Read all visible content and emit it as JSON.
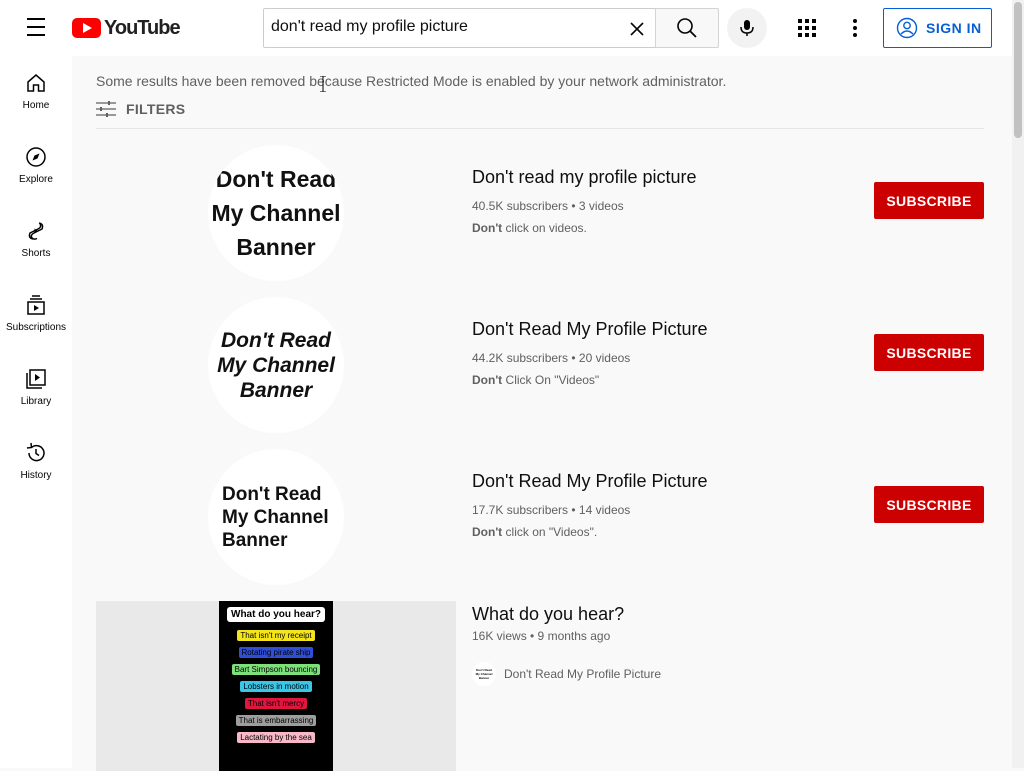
{
  "header": {
    "logo_text": "YouTube",
    "search_value": "don't read my profile picture",
    "signin_label": "SIGN IN"
  },
  "sidebar": {
    "items": [
      {
        "label": "Home",
        "icon": "home-icon"
      },
      {
        "label": "Explore",
        "icon": "compass-icon"
      },
      {
        "label": "Shorts",
        "icon": "shorts-icon"
      },
      {
        "label": "Subscriptions",
        "icon": "subscriptions-icon"
      },
      {
        "label": "Library",
        "icon": "library-icon"
      },
      {
        "label": "History",
        "icon": "history-icon"
      }
    ]
  },
  "main": {
    "notice": "Some results have been removed because Restricted Mode is enabled by your network administrator.",
    "filters_label": "FILTERS",
    "subscribe_label": "SUBSCRIBE",
    "channels": [
      {
        "avatar_lines": [
          "Don't Read",
          "My Channel",
          "Banner"
        ],
        "title": "Don't read my profile picture",
        "meta": "40.5K subscribers • 3 videos",
        "desc_bold": "Don't",
        "desc_rest": " click on videos."
      },
      {
        "avatar_lines": [
          "Don't Read",
          "My Channel",
          "Banner"
        ],
        "title": "Don't Read My Profile Picture",
        "meta": "44.2K subscribers • 20 videos",
        "desc_bold": "Don't",
        "desc_rest": " Click On \"Videos\""
      },
      {
        "avatar_lines": [
          "Don't Read",
          "My Channel",
          "Banner"
        ],
        "title": "Don't Read My Profile Picture",
        "meta": "17.7K subscribers • 14 videos",
        "desc_bold": "Don't",
        "desc_rest": " click on \"Videos\"."
      }
    ],
    "video": {
      "title": "What do you hear?",
      "meta": "16K views • 9 months ago",
      "channel_name": "Don't Read My Profile Picture",
      "channel_avatar_lines": [
        "Don't Read",
        "My Channel",
        "Banner"
      ],
      "thumb_heading": "What do you hear?",
      "thumb_chips": [
        {
          "text": "That isn't my receipt",
          "color": "#f5e51b"
        },
        {
          "text": "Rotating pirate ship",
          "color": "#2f4fd8"
        },
        {
          "text": "Bart Simpson bouncing",
          "color": "#7de07a"
        },
        {
          "text": "Lobsters in motion",
          "color": "#3ac6e8"
        },
        {
          "text": "That isn't mercy",
          "color": "#e0163f"
        },
        {
          "text": "That is embarrassing",
          "color": "#9e9e9e"
        },
        {
          "text": "Lactating by the sea",
          "color": "#f7b8c8"
        }
      ]
    }
  }
}
